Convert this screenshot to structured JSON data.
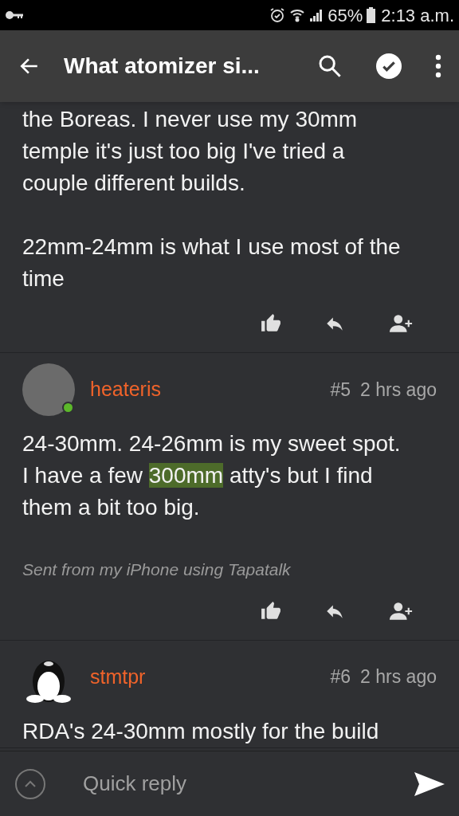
{
  "status_bar": {
    "battery": "65%",
    "time": "2:13 a.m."
  },
  "app_bar": {
    "title": "What atomizer si..."
  },
  "posts": [
    {
      "kind": "continued",
      "paragraphs": [
        [
          {
            "text": "the Boreas. I never use my 30mm temple it's just too big I've tried a couple different builds.",
            "highlighted": false
          }
        ],
        [
          {
            "text": "22mm-24mm is what I use most of the time",
            "highlighted": false
          }
        ]
      ],
      "actions": true
    },
    {
      "kind": "full",
      "avatar": {
        "kind": "photo"
      },
      "online": true,
      "author": "heateris",
      "number": "#5",
      "time": "2 hrs ago",
      "paragraphs": [
        [
          {
            "text": "24-30mm. 24-26mm is my sweet spot. I have a few ",
            "highlighted": false
          },
          {
            "text": "300mm",
            "highlighted": true
          },
          {
            "text": " atty's but I find them a bit too big.",
            "highlighted": false
          }
        ]
      ],
      "signature": "Sent from my iPhone using Tapatalk",
      "actions": true
    },
    {
      "kind": "full",
      "avatar": {
        "kind": "penguin"
      },
      "online": false,
      "author": "stmtpr",
      "number": "#6",
      "time": "2 hrs ago",
      "paragraphs": [
        [
          {
            "text": "RDA's 24-30mm mostly for the build",
            "highlighted": false
          }
        ]
      ],
      "actions": false
    }
  ],
  "reply_bar": {
    "placeholder": "Quick reply"
  }
}
